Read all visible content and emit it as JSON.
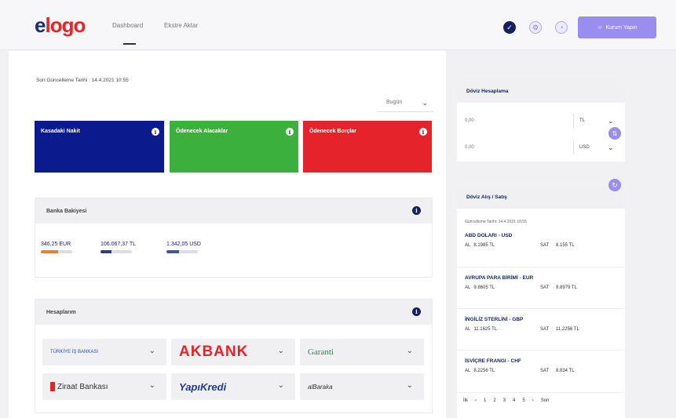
{
  "header": {
    "logo_e": "e",
    "logo_rest": "logo",
    "nav": [
      "Dashboard",
      "Ekstre Aktar"
    ],
    "login_label": "Kurum Yapın"
  },
  "main": {
    "last_updated": "Son Güncelleme Tarihi : 14.4.2021 10:55",
    "date_filter": "Bugün",
    "cards": [
      {
        "label": "Kasadaki Nakit",
        "color": "#0b1a8c"
      },
      {
        "label": "Ödenecek Alacaklar",
        "color": "#3cb03c"
      },
      {
        "label": "Ödenecek Borçlar",
        "color": "#e4232b"
      }
    ],
    "bank_balances": {
      "title": "Banka Bakiyesi",
      "items": [
        {
          "amount": "346,25",
          "currency": "EUR",
          "fill": 0.55,
          "color": "#e8803a"
        },
        {
          "amount": "106.067,37",
          "currency": "TL",
          "fill": 0.35,
          "color": "#2d3f74"
        },
        {
          "amount": "1.342,05",
          "currency": "USD",
          "fill": 0.4,
          "color": "#3e5a8a"
        }
      ]
    },
    "accounts": {
      "title": "Hesaplarım",
      "banks": [
        "TÜRKİYE İŞ BANKASI",
        "AKBANK",
        "Garanti",
        "Ziraat Bankası",
        "YapıKredi",
        "alBaraka"
      ]
    }
  },
  "side": {
    "converter": {
      "title": "Döviz Hesaplama",
      "rows": [
        {
          "amount": "0,00",
          "currency": "TL"
        },
        {
          "amount": "0,00",
          "currency": "USD"
        }
      ]
    },
    "rates": {
      "title": "Döviz Alış / Satış",
      "updated": "Güncelleme Tarihi: 14.4.2021 10:55",
      "buy_label": "AL",
      "sell_label": "SAT",
      "items": [
        {
          "name": "ABD DOLARI - USD",
          "buy": "8.1985 TL",
          "sell": "8.155 TL"
        },
        {
          "name": "AVRUPA PARA BİRİMİ - EUR",
          "buy": "9.8605 TL",
          "sell": "9.8979 TL"
        },
        {
          "name": "İNGİLİZ STERLİNİ - GBP",
          "buy": "11.1625 TL",
          "sell": "11.2256 TL"
        },
        {
          "name": "İSVİÇRE FRANGI - CHF",
          "buy": "8.2256 TL",
          "sell": "8.834 TL"
        }
      ],
      "pager": [
        "İlk",
        "‹",
        "1",
        "2",
        "3",
        "4",
        "5",
        "›",
        "Son"
      ]
    }
  }
}
